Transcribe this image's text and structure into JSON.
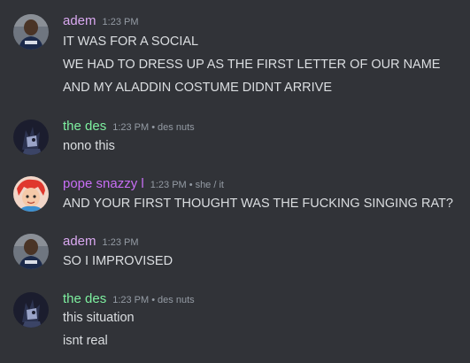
{
  "messages": [
    {
      "author": "adem",
      "time": "1:23 PM",
      "pronouns": "",
      "name_color": "#d9a8f0",
      "avatar": "adem-avatar",
      "lines": [
        "IT WAS FOR A SOCIAL",
        "WE HAD TO DRESS UP AS THE FIRST LETTER OF OUR NAME",
        "AND MY ALADDIN COSTUME DIDNT ARRIVE"
      ]
    },
    {
      "author": "the des",
      "time": "1:23 PM",
      "pronouns": "des nuts",
      "name_color": "#7ef0a0",
      "avatar": "des-avatar",
      "lines": [
        "nono this"
      ]
    },
    {
      "author": "pope snazzy l",
      "time": "1:23 PM",
      "pronouns": "she / it",
      "name_color": "#c86ef5",
      "avatar": "pope-avatar",
      "lines": [
        "AND YOUR FIRST THOUGHT WAS THE FUCKING SINGING RAT?"
      ]
    },
    {
      "author": "adem",
      "time": "1:23 PM",
      "pronouns": "",
      "name_color": "#d9a8f0",
      "avatar": "adem-avatar",
      "lines": [
        "SO I IMPROVISED"
      ]
    },
    {
      "author": "the des",
      "time": "1:23 PM",
      "pronouns": "des nuts",
      "name_color": "#7ef0a0",
      "avatar": "des-avatar",
      "lines": [
        "this situation",
        "isnt real"
      ]
    }
  ],
  "separator": "•",
  "colors": {
    "background": "#313338",
    "text": "#dbdee1",
    "muted": "#949ba4"
  }
}
